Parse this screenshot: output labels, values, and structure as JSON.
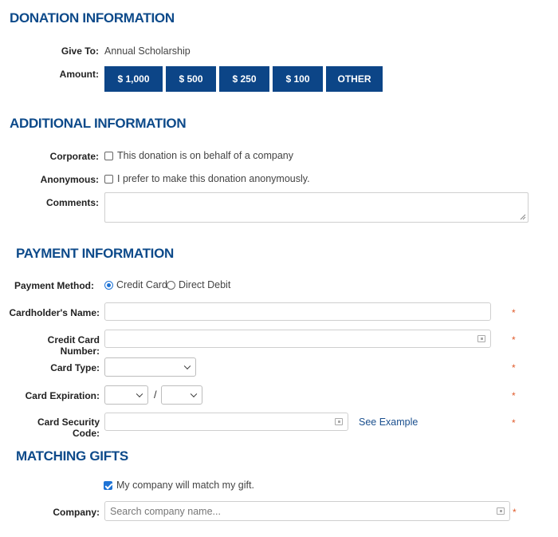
{
  "donation": {
    "title": "DONATION INFORMATION",
    "give_to_label": "Give To:",
    "give_to_value": "Annual Scholarship",
    "amount_label": "Amount:",
    "amounts": [
      "$ 1,000",
      "$ 500",
      "$ 250",
      "$ 100",
      "OTHER"
    ]
  },
  "additional": {
    "title": "ADDITIONAL INFORMATION",
    "corporate_label": "Corporate:",
    "corporate_text": "This donation is on behalf of a company",
    "corporate_checked": false,
    "anonymous_label": "Anonymous:",
    "anonymous_text": "I prefer to make this donation anonymously.",
    "anonymous_checked": false,
    "comments_label": "Comments:",
    "comments_value": ""
  },
  "payment": {
    "title": "PAYMENT INFORMATION",
    "method_label": "Payment Method:",
    "method_options": [
      "Credit Card",
      "Direct Debit"
    ],
    "method_selected": "Credit Card",
    "cardholder_label": "Cardholder's Name:",
    "card_number_label": "Credit Card Number:",
    "card_type_label": "Card Type:",
    "expiration_label": "Card Expiration:",
    "expiration_separator": "/",
    "security_label": "Card Security Code:",
    "see_example": "See Example",
    "required_mark": "*"
  },
  "matching": {
    "title": "MATCHING GIFTS",
    "match_text": "My company will match my gift.",
    "match_checked": true,
    "company_label": "Company:",
    "company_placeholder": "Search company name..."
  },
  "colors": {
    "heading": "#0d4a8a",
    "button_bg": "#0c4587",
    "checkbox_accent": "#1e73d6",
    "required": "#e05a2a",
    "link": "#1a4f8e"
  }
}
